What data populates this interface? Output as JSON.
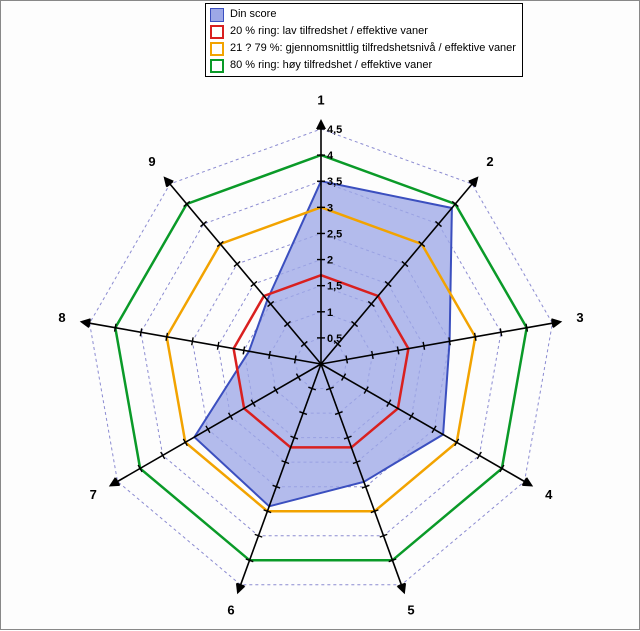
{
  "chart_data": {
    "type": "radar",
    "categories": [
      "1",
      "2",
      "3",
      "4",
      "5",
      "6",
      "7",
      "8",
      "9"
    ],
    "radial_ticks": [
      0.5,
      1,
      1.5,
      2,
      2.5,
      3,
      3.5,
      4,
      4.5
    ],
    "max": 4.5,
    "series": [
      {
        "name": "Din score",
        "color_line": "#3b4fbf",
        "color_fill": "#9da8e7",
        "values": [
          3.5,
          3.9,
          2.5,
          2.7,
          2.4,
          2.9,
          2.8,
          1.4,
          1.6
        ]
      },
      {
        "name": "20 % ring: lav tilfredshet / effektive vaner",
        "color_line": "#d9201f",
        "values": [
          1.7,
          1.7,
          1.7,
          1.7,
          1.7,
          1.7,
          1.7,
          1.7,
          1.7
        ]
      },
      {
        "name": "21 ? 79 %: gjennomsnittlig tilfredshetsnivå / effektive vaner",
        "color_line": "#f2a300",
        "values": [
          3.0,
          3.0,
          3.0,
          3.0,
          3.0,
          3.0,
          3.0,
          3.0,
          3.0
        ]
      },
      {
        "name": "80 % ring: høy tilfredshet / effektive vaner",
        "color_line": "#0a9a28",
        "values": [
          4.0,
          4.0,
          4.0,
          4.0,
          4.0,
          4.0,
          4.0,
          4.0,
          4.0
        ]
      }
    ]
  },
  "colors": {
    "grid_dash": "#8b8bd1",
    "axis": "#000000"
  }
}
